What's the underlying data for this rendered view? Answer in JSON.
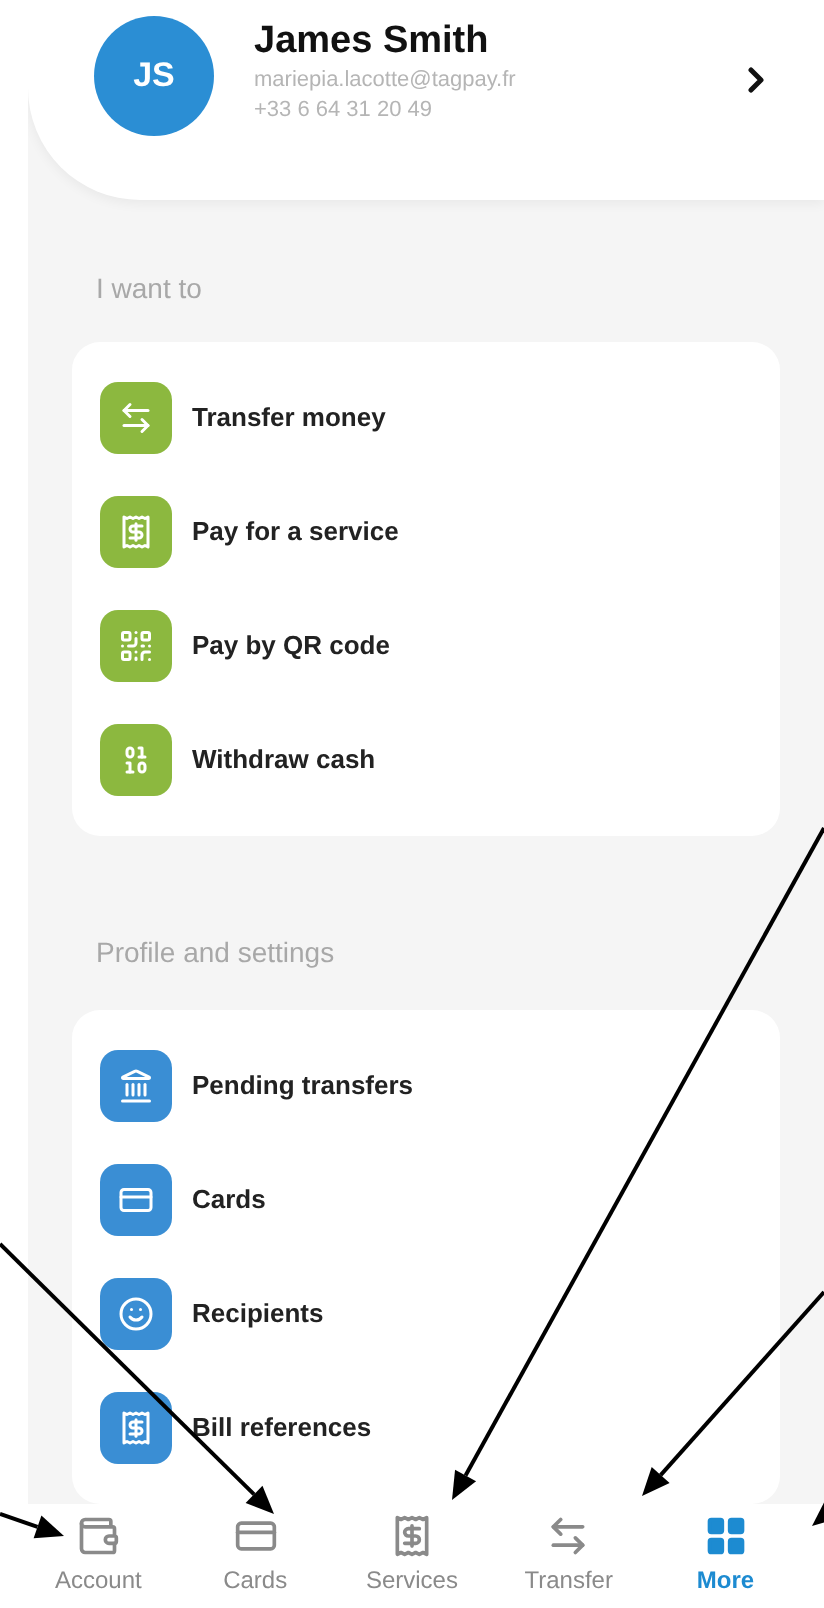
{
  "profile": {
    "initials": "JS",
    "name": "James Smith",
    "email": "mariepia.lacotte@tagpay.fr",
    "phone": "+33 6 64 31 20 49"
  },
  "sections": [
    {
      "title": "I want to",
      "kind": "actions",
      "items": [
        {
          "label": "Transfer money",
          "kind": "transfer"
        },
        {
          "label": "Pay for a service",
          "kind": "receipt"
        },
        {
          "label": "Pay by QR code",
          "kind": "qr"
        },
        {
          "label": "Withdraw cash",
          "kind": "binary"
        }
      ]
    },
    {
      "title": "Profile and settings",
      "kind": "settings",
      "items": [
        {
          "label": "Pending transfers",
          "kind": "bank"
        },
        {
          "label": "Cards",
          "kind": "card"
        },
        {
          "label": "Recipients",
          "kind": "smile"
        },
        {
          "label": "Bill references",
          "kind": "receipt"
        }
      ]
    }
  ],
  "tab_bar": [
    {
      "label": "Account",
      "kind": "wallet",
      "selected": false
    },
    {
      "label": "Cards",
      "kind": "card",
      "selected": false
    },
    {
      "label": "Services",
      "kind": "receipt",
      "selected": false
    },
    {
      "label": "Transfer",
      "kind": "transfer",
      "selected": false
    },
    {
      "label": "More",
      "kind": "grid",
      "selected": true
    }
  ]
}
